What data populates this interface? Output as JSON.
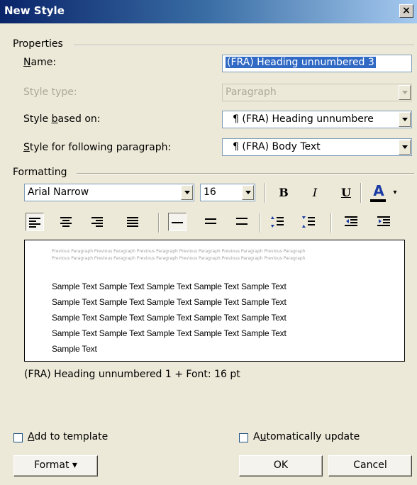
{
  "window": {
    "title": "New Style",
    "close": "×"
  },
  "properties": {
    "group_label": "Properties",
    "name_label": "Name:",
    "name_value": "(FRA) Heading unnumbered 3",
    "style_type_label": "Style type:",
    "style_type_value": "Paragraph",
    "based_on_label": "Style based on:",
    "based_on_value": "¶ (FRA) Heading unnumbere",
    "following_label": "Style for following paragraph:",
    "following_value": "¶ (FRA) Body Text"
  },
  "formatting": {
    "group_label": "Formatting",
    "font": "Arial Narrow",
    "size": "16",
    "bold": "B",
    "italic": "I",
    "underline": "U",
    "font_color": "A"
  },
  "preview": {
    "previous_lines": [
      "Previous Paragraph Previous Paragraph Previous Paragraph Previous Paragraph Previous Paragraph Previous Paragraph",
      "Previous Paragraph Previous Paragraph Previous Paragraph Previous Paragraph Previous Paragraph Previous Paragraph"
    ],
    "sample_lines": [
      "Sample Text Sample Text Sample Text Sample Text Sample Text",
      "Sample Text Sample Text Sample Text Sample Text Sample Text",
      "Sample Text Sample Text Sample Text Sample Text Sample Text",
      "Sample Text Sample Text Sample Text Sample Text Sample Text",
      "Sample Text"
    ]
  },
  "description": "(FRA) Heading unnumbered 1 + Font: 16 pt",
  "footer": {
    "add_to_template": "Add to template",
    "auto_update": "Automatically update",
    "format_button": "Format ▾",
    "ok_button": "OK",
    "cancel_button": "Cancel"
  },
  "colors": {
    "font_color_bar": "#000000",
    "selection": "#316ac5"
  }
}
